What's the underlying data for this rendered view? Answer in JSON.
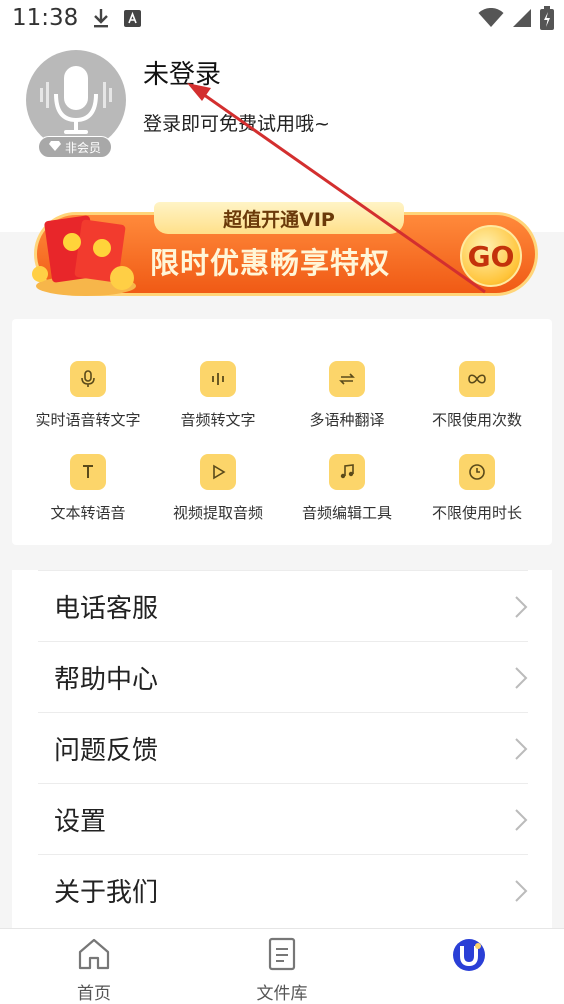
{
  "status_bar": {
    "time": "11:38"
  },
  "profile": {
    "title": "未登录",
    "subtitle": "登录即可免费试用哦~",
    "member_badge": "非会员"
  },
  "vip_banner": {
    "tab_label": "超值开通VIP",
    "main_text": "限时优惠畅享特权",
    "go_label": "GO"
  },
  "features": [
    {
      "label": "实时语音转文字",
      "icon": "microphone-icon"
    },
    {
      "label": "音频转文字",
      "icon": "audio-wave-icon"
    },
    {
      "label": "多语种翻译",
      "icon": "translate-icon"
    },
    {
      "label": "不限使用次数",
      "icon": "infinity-icon"
    },
    {
      "label": "文本转语音",
      "icon": "text-icon"
    },
    {
      "label": "视频提取音频",
      "icon": "play-icon"
    },
    {
      "label": "音频编辑工具",
      "icon": "music-note-icon"
    },
    {
      "label": "不限使用时长",
      "icon": "clock-icon"
    }
  ],
  "menu": [
    {
      "label": "电话客服"
    },
    {
      "label": "帮助中心"
    },
    {
      "label": "问题反馈"
    },
    {
      "label": "设置"
    },
    {
      "label": "关于我们"
    }
  ],
  "bottom_nav": [
    {
      "label": "首页",
      "icon": "home-icon"
    },
    {
      "label": "文件库",
      "icon": "document-icon"
    },
    {
      "label": "",
      "icon": "profile-logo-icon"
    }
  ],
  "colors": {
    "accent_yellow": "#fcd56a",
    "banner_orange": "#f05a15",
    "annotation_red": "#d32f2f",
    "nav_active": "#2a3fd6"
  }
}
